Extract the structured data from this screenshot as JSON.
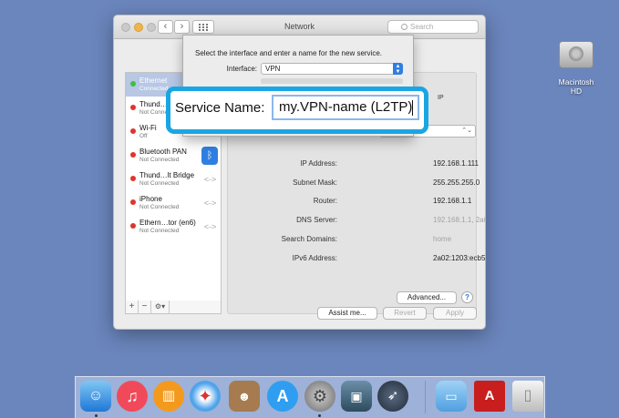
{
  "window": {
    "title": "Network",
    "search_placeholder": "Search",
    "nav_back": "‹",
    "nav_forward": "›"
  },
  "sidebar": {
    "items": [
      {
        "name": "Ethernet",
        "status": "Connected",
        "dot": "#3fbf3f",
        "selected": true,
        "icon": ""
      },
      {
        "name": "Thund…",
        "status": "Not Connected",
        "dot": "#e0342e",
        "icon": ""
      },
      {
        "name": "Wi-Fi",
        "status": "Off",
        "dot": "#e0342e",
        "icon": ""
      },
      {
        "name": "Bluetooth PAN",
        "status": "Not Connected",
        "dot": "#e0342e",
        "icon": "bluetooth-icon"
      },
      {
        "name": "Thund…lt Bridge",
        "status": "Not Connected",
        "dot": "#e0342e",
        "icon": "network-arrows-icon"
      },
      {
        "name": "iPhone",
        "status": "Not Connected",
        "dot": "#e0342e",
        "icon": "network-arrows-icon"
      },
      {
        "name": "Ethern…tor (en6)",
        "status": "Not Connected",
        "dot": "#e0342e",
        "icon": "network-arrows-icon"
      }
    ],
    "toolbar": {
      "add": "+",
      "remove": "−",
      "gear": "⚙▾"
    }
  },
  "details": {
    "rows": [
      {
        "label": "IP Address:",
        "value": "192.168.1.111",
        "muted": false
      },
      {
        "label": "Subnet Mask:",
        "value": "255.255.255.0",
        "muted": false
      },
      {
        "label": "Router:",
        "value": "192.168.1.1",
        "muted": false
      },
      {
        "label": "DNS Server:",
        "value": "192.168.1.1, 2a02:1203:ecb5:4e40:7…",
        "muted": true
      },
      {
        "label": "Search Domains:",
        "value": "home",
        "muted": true
      },
      {
        "label": "IPv6 Address:",
        "value": "2a02:1203:ecb5:4…2dd:b1ff:fea1:2b02",
        "muted": false
      }
    ],
    "partial_text": "IP",
    "advanced_label": "Advanced...",
    "help_label": "?"
  },
  "footer": {
    "assist_label": "Assist me...",
    "revert_label": "Revert",
    "apply_label": "Apply"
  },
  "sheet": {
    "instruction": "Select the interface and enter a name for the new service.",
    "interface_label": "Interface:",
    "interface_value": "VPN"
  },
  "callout": {
    "label": "Service Name:",
    "value": "my.VPN-name (L2TP)"
  },
  "desktop": {
    "drive_label_line1": "Macintosh",
    "drive_label_line2": "HD"
  },
  "colors": {
    "accent": "#2f7fe0",
    "callout_border": "#1aa6e3",
    "desktop": "#6b86bd"
  }
}
